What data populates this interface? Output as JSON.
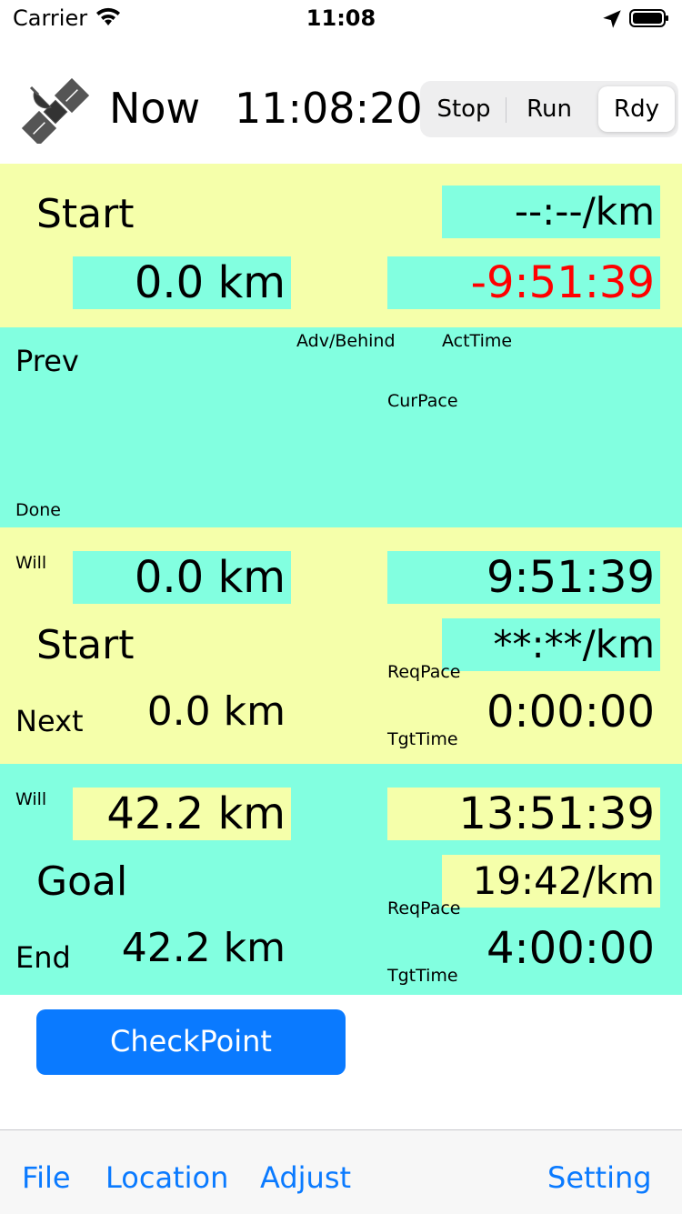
{
  "status": {
    "carrier": "Carrier",
    "time": "11:08"
  },
  "header": {
    "now_label": "Now",
    "clock": "11:08:20",
    "segment": [
      "Stop",
      "Run",
      "Rdy"
    ],
    "selected": "Rdy"
  },
  "start": {
    "title": "Start",
    "pace": "--:--/km",
    "distance": "0.0 km",
    "time": "-9:51:39",
    "time_color": "#ff0000"
  },
  "prev": {
    "title": "Prev",
    "adv_label": "Adv/Behind",
    "acttime_label": "ActTime",
    "curpace_label": "CurPace",
    "done_label": "Done"
  },
  "next": {
    "will_label": "Will",
    "will_distance": "0.0 km",
    "will_time": "9:51:39",
    "name": "Start",
    "req_pace": "**:**/km",
    "req_pace_label": "ReqPace",
    "label": "Next",
    "distance": "0.0 km",
    "tgt_time": "0:00:00",
    "tgt_label": "TgtTime"
  },
  "goal": {
    "will_label": "Will",
    "will_distance": "42.2 km",
    "will_time": "13:51:39",
    "name": "Goal",
    "req_pace": "19:42/km",
    "req_pace_label": "ReqPace",
    "label": "End",
    "distance": "42.2 km",
    "tgt_time": "4:00:00",
    "tgt_label": "TgtTime"
  },
  "checkpoint_label": "CheckPoint",
  "toolbar": {
    "file": "File",
    "location": "Location",
    "adjust": "Adjust",
    "setting": "Setting"
  },
  "colors": {
    "yellow": "#f5ffaa",
    "cyan": "#82ffe0",
    "accent": "#0a7aff"
  },
  "icons": {
    "satellite": "satellite-icon",
    "location": "location-arrow-icon",
    "battery": "battery-icon",
    "wifi": "wifi-icon"
  }
}
